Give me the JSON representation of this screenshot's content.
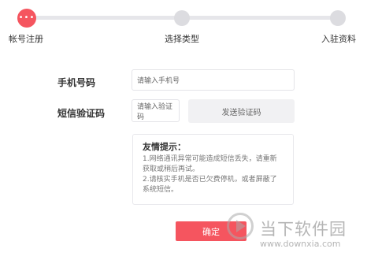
{
  "steps": [
    {
      "label": "帐号注册",
      "active": true
    },
    {
      "label": "选择类型",
      "active": false
    },
    {
      "label": "入驻资料",
      "active": false
    }
  ],
  "active_step_glyph": "•••",
  "form": {
    "phone_label": "手机号码",
    "phone_placeholder": "请输入手机号",
    "code_label": "短信验证码",
    "code_placeholder": "请输入验证码",
    "send_code_label": "发送验证码"
  },
  "tips": {
    "title": "友情提示：",
    "lines": [
      "1.网络通讯异常可能造成短信丢失，请重新",
      "获取或稍后再试。",
      "2.请核实手机是否已欠费停机，或者屏蔽了",
      "系统短信。"
    ]
  },
  "confirm_label": "确定",
  "watermark": {
    "text": "当下软件园",
    "url": "www.downxia.com"
  },
  "colors": {
    "accent": "#f5555f",
    "inactive_step": "#dcdce0"
  }
}
